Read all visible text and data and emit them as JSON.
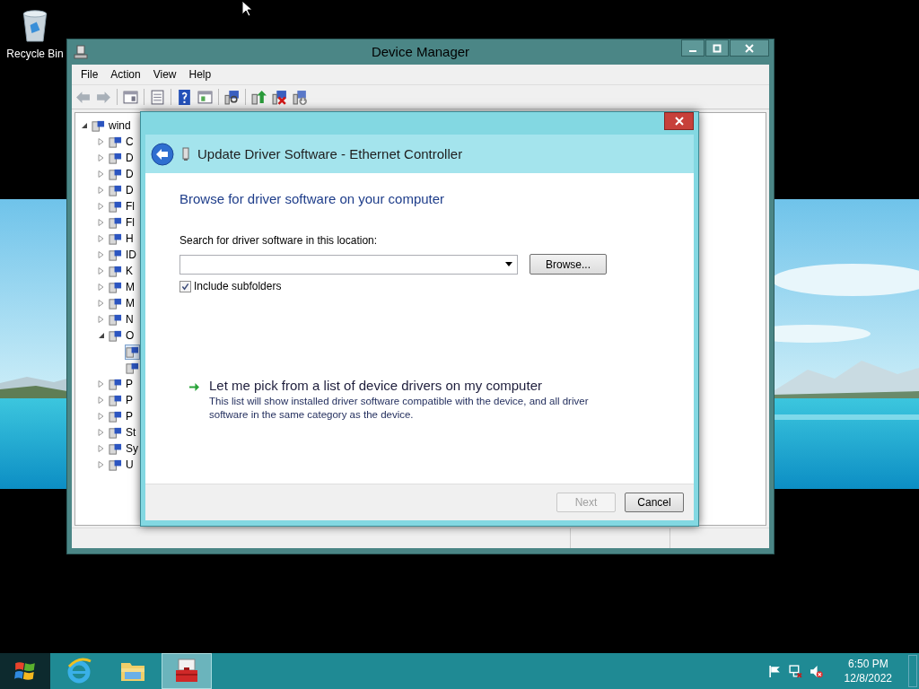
{
  "desktop": {
    "icons": [
      {
        "label": "Recycle Bin"
      }
    ]
  },
  "device_manager": {
    "title": "Device Manager",
    "menu": [
      "File",
      "Action",
      "View",
      "Help"
    ],
    "tree": [
      {
        "label": "wind",
        "expanded": true,
        "children": [
          {
            "label": "C",
            "expanded": false
          },
          {
            "label": "D",
            "expanded": false
          },
          {
            "label": "D",
            "expanded": false
          },
          {
            "label": "D",
            "expanded": false
          },
          {
            "label": "Fl",
            "expanded": false
          },
          {
            "label": "Fl",
            "expanded": false
          },
          {
            "label": "H",
            "expanded": false
          },
          {
            "label": "ID",
            "expanded": false
          },
          {
            "label": "K",
            "expanded": false
          },
          {
            "label": "M",
            "expanded": false
          },
          {
            "label": "M",
            "expanded": false
          },
          {
            "label": "N",
            "expanded": false
          },
          {
            "label": "O",
            "expanded": true,
            "children": [
              {
                "selected": true
              },
              {
                "selected": false
              }
            ]
          },
          {
            "label": "P",
            "expanded": false
          },
          {
            "label": "P",
            "expanded": false
          },
          {
            "label": "P",
            "expanded": false
          },
          {
            "label": "St",
            "expanded": false
          },
          {
            "label": "Sy",
            "expanded": false
          },
          {
            "label": "U",
            "expanded": false
          }
        ]
      }
    ]
  },
  "dialog": {
    "title": "Update Driver Software - Ethernet Controller",
    "heading": "Browse for driver software on your computer",
    "location_label": "Search for driver software in this location:",
    "browse_button": "Browse...",
    "include_subfolders": {
      "label": "Include subfolders",
      "checked": true
    },
    "option": {
      "title": "Let me pick from a list of device drivers on my computer",
      "description": "This list will show installed driver software compatible with the device, and all driver software in the same category as the device."
    },
    "buttons": [
      {
        "label": "Next",
        "disabled": true
      },
      {
        "label": "Cancel",
        "disabled": false
      }
    ]
  },
  "taskbar": {
    "apps": [
      {
        "kind": "browser",
        "selected": false
      },
      {
        "kind": "folder",
        "selected": false
      },
      {
        "kind": "toolbox",
        "selected": true
      }
    ],
    "clock": {
      "time": "6:50 PM",
      "date": "12/8/2022"
    }
  }
}
